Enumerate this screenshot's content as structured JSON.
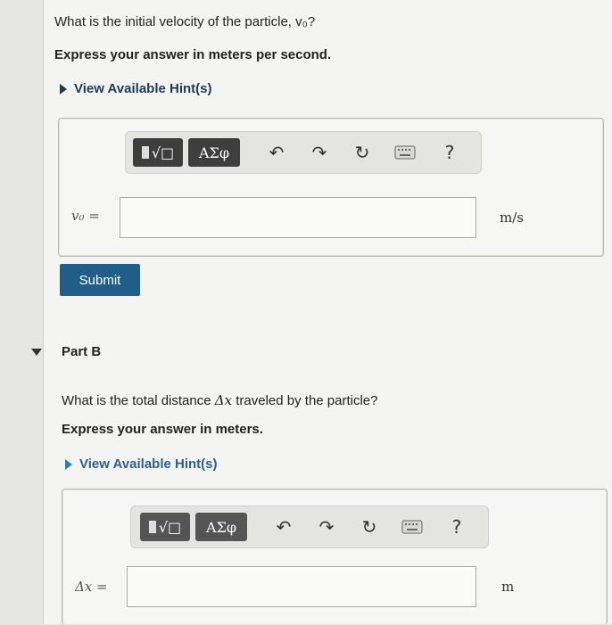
{
  "partA": {
    "question": "What is the initial velocity of the particle, v₀?",
    "instruction": "Express your answer in meters per second.",
    "hint_label": "View Available Hint(s)",
    "answer_label": "v₀ =",
    "answer_value": "",
    "units": "m/s",
    "submit_label": "Submit"
  },
  "partB": {
    "title": "Part B",
    "question_pre": "What is the total distance ",
    "question_var": "Δx",
    "question_post": " traveled by the particle?",
    "instruction": "Express your answer in meters.",
    "hint_label": "View Available Hint(s)",
    "answer_label": "Δx =",
    "answer_value": "",
    "units": "m"
  },
  "toolbar": {
    "template_glyph": "√□",
    "symbols_label": "ΑΣφ",
    "undo_glyph": "↶",
    "redo_glyph": "↷",
    "reset_glyph": "↻",
    "help_glyph": "?"
  },
  "colors": {
    "submit": "#1f5e88",
    "hint": "#1d3a57",
    "toolbar_button": "#3e3e3e"
  }
}
